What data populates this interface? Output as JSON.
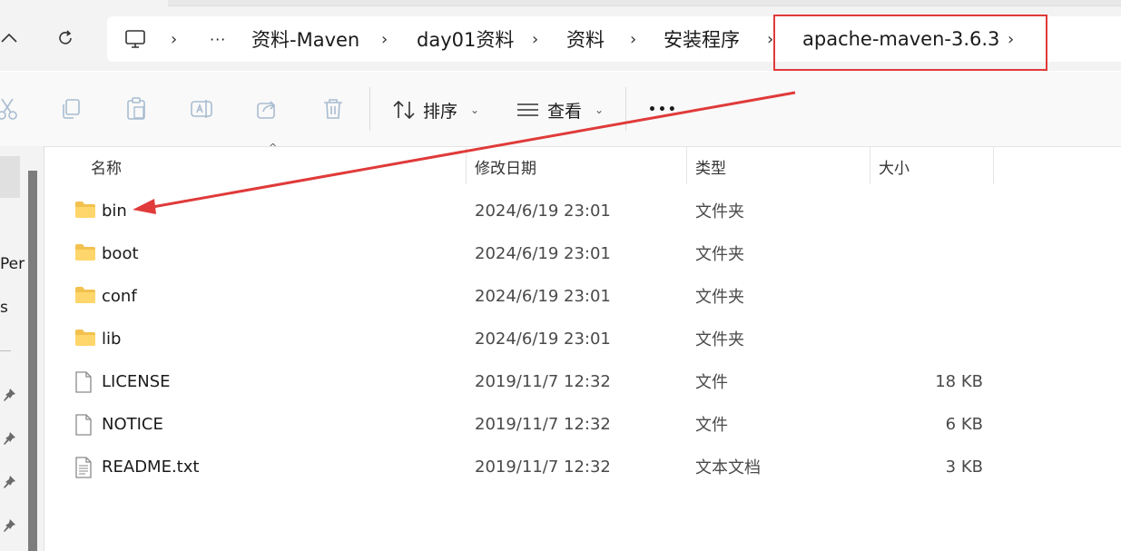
{
  "breadcrumb": {
    "ellipsis": "···",
    "items": [
      "资料-Maven",
      "day01资料",
      "资料",
      "安装程序",
      "apache-maven-3.6.3"
    ]
  },
  "toolbar": {
    "sort_label": "排序",
    "view_label": "查看",
    "more_label": "•••"
  },
  "left_pane": {
    "partial_texts": [
      "Per",
      "s"
    ]
  },
  "columns": {
    "name": "名称",
    "date": "修改日期",
    "type": "类型",
    "size": "大小"
  },
  "files": [
    {
      "name": "bin",
      "date": "2024/6/19 23:01",
      "type": "文件夹",
      "size": "",
      "icon": "folder-icon"
    },
    {
      "name": "boot",
      "date": "2024/6/19 23:01",
      "type": "文件夹",
      "size": "",
      "icon": "folder-icon"
    },
    {
      "name": "conf",
      "date": "2024/6/19 23:01",
      "type": "文件夹",
      "size": "",
      "icon": "folder-icon"
    },
    {
      "name": "lib",
      "date": "2024/6/19 23:01",
      "type": "文件夹",
      "size": "",
      "icon": "folder-icon"
    },
    {
      "name": "LICENSE",
      "date": "2019/11/7 12:32",
      "type": "文件",
      "size": "18 KB",
      "icon": "file-icon"
    },
    {
      "name": "NOTICE",
      "date": "2019/11/7 12:32",
      "type": "文件",
      "size": "6 KB",
      "icon": "file-icon"
    },
    {
      "name": "README.txt",
      "date": "2019/11/7 12:32",
      "type": "文本文档",
      "size": "3 KB",
      "icon": "text-file-icon"
    }
  ],
  "annotation": {
    "color": "#e03a3a"
  }
}
